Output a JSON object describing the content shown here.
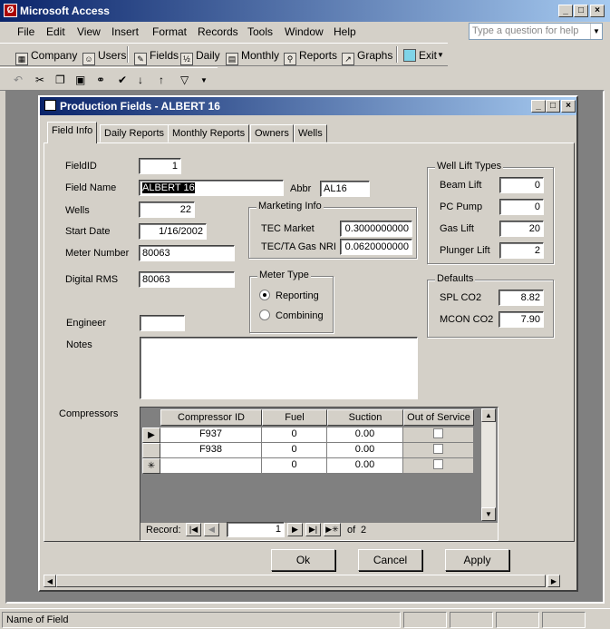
{
  "app": {
    "title": "Microsoft Access",
    "icon_name": "access-key-icon",
    "title_gradient": [
      "#0a246a",
      "#a6caf0"
    ]
  },
  "menu": [
    "File",
    "Edit",
    "View",
    "Insert",
    "Format",
    "Records",
    "Tools",
    "Window",
    "Help"
  ],
  "help_box": {
    "placeholder": "Type a question for help"
  },
  "toolbar": {
    "items": [
      {
        "label": "Company",
        "icon": "company-icon"
      },
      {
        "label": "Users",
        "icon": "users-icon"
      },
      {
        "label": "Fields",
        "icon": "fields-icon"
      },
      {
        "label": "Daily",
        "icon": "daily-icon"
      },
      {
        "label": "Monthly",
        "icon": "monthly-icon"
      },
      {
        "label": "Reports",
        "icon": "reports-icon"
      },
      {
        "label": "Graphs",
        "icon": "graphs-icon"
      },
      {
        "label": "Exit",
        "icon": "exit-icon"
      }
    ]
  },
  "form": {
    "title": "Production Fields - ALBERT 16",
    "tabs": [
      "Field Info",
      "Daily Reports",
      "Monthly Reports",
      "Owners",
      "Wells"
    ],
    "active_tab": "Field Info",
    "field_id": {
      "label": "FieldID",
      "value": "1"
    },
    "field_name": {
      "label": "Field Name",
      "value": "ALBERT 16"
    },
    "abbr": {
      "label": "Abbr",
      "value": "AL16"
    },
    "wells": {
      "label": "Wells",
      "value": "22"
    },
    "start_date": {
      "label": "Start Date",
      "value": "1/16/2002"
    },
    "meter_number": {
      "label": "Meter Number",
      "value": "80063"
    },
    "digital_rms": {
      "label": "Digital RMS",
      "value": "80063"
    },
    "engineer": {
      "label": "Engineer",
      "value": ""
    },
    "notes": {
      "label": "Notes",
      "value": ""
    },
    "marketing": {
      "title": "Marketing Info",
      "tec_market": {
        "label": "TEC Market",
        "value": "0.3000000000"
      },
      "tec_ta_gas_nri": {
        "label": "TEC/TA Gas NRI",
        "value": "0.0620000000"
      }
    },
    "meter_type": {
      "title": "Meter Type",
      "options": [
        "Reporting",
        "Combining"
      ],
      "selected": "Reporting"
    },
    "well_lift": {
      "title": "Well Lift Types",
      "items": [
        {
          "label": "Beam Lift",
          "value": "0"
        },
        {
          "label": "PC Pump",
          "value": "0"
        },
        {
          "label": "Gas Lift",
          "value": "20"
        },
        {
          "label": "Plunger Lift",
          "value": "2"
        }
      ]
    },
    "defaults": {
      "title": "Defaults",
      "spl_co2": {
        "label": "SPL CO2",
        "value": "8.82"
      },
      "mcon_co2": {
        "label": "MCON CO2",
        "value": "7.90"
      }
    },
    "compressors": {
      "label": "Compressors",
      "columns": [
        "Compressor ID",
        "Fuel",
        "Suction",
        "Out of Service"
      ],
      "rows": [
        {
          "id": "F937",
          "fuel": "0",
          "suction": "0.00"
        },
        {
          "id": "F938",
          "fuel": "0",
          "suction": "0.00"
        },
        {
          "id": "",
          "fuel": "0",
          "suction": "0.00"
        }
      ],
      "record_label": "Record:",
      "record_current": "1",
      "record_of": "of",
      "record_total": "2"
    },
    "buttons": {
      "ok": "Ok",
      "cancel": "Cancel",
      "apply": "Apply"
    }
  },
  "status": {
    "text": "Name of Field"
  }
}
